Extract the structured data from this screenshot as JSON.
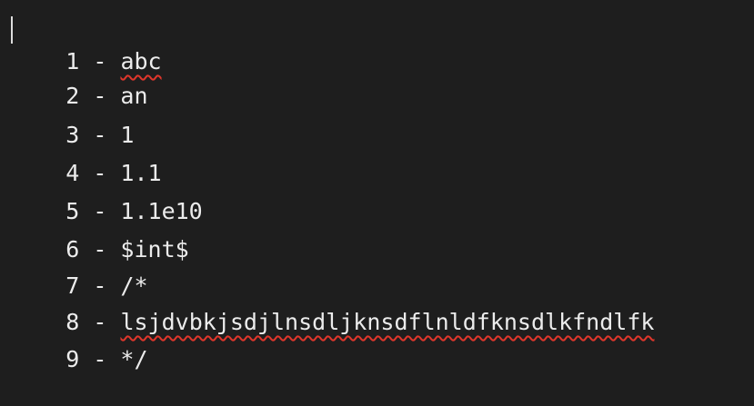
{
  "editor": {
    "lines": [
      {
        "text": "1 - abc",
        "spellcheck_word": "abc"
      },
      {
        "text": "2 - an"
      },
      {
        "text": "3 - 1"
      },
      {
        "text": "4 - 1.1"
      },
      {
        "text": "5 - 1.1e10"
      },
      {
        "text": "6 - $int$"
      },
      {
        "text": "7 - /*"
      },
      {
        "text": "8 - lsjdvbkjsdjlnsdljknsdflnldfknsdlkfndlfk",
        "spellcheck_word": "lsjdvbkjsdjlnsdljknsdflnldfknsdlkfndlfk"
      },
      {
        "text": "9 - */"
      }
    ],
    "colors": {
      "background": "#1e1e1e",
      "text": "#ececec",
      "spellcheck_underline": "#e0362b"
    }
  }
}
